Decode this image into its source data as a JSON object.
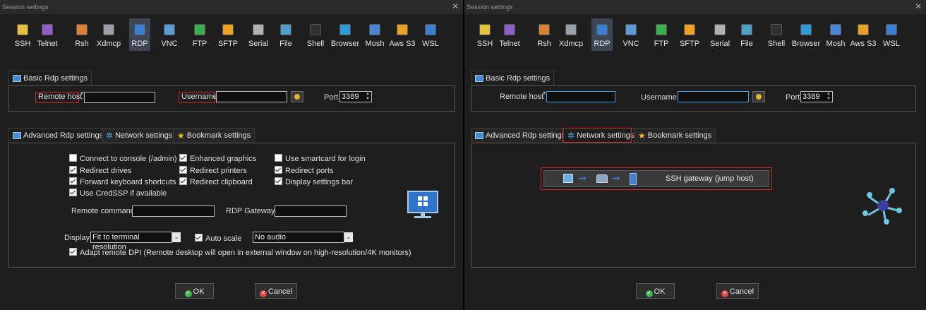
{
  "left": {
    "title": "Session settings",
    "toolbar": [
      {
        "label": "SSH",
        "icon": "ssh-icon",
        "color": "#e3c13b"
      },
      {
        "label": "Telnet",
        "icon": "telnet-icon",
        "color": "#8d5fc7"
      },
      {
        "label": "Rsh",
        "icon": "rsh-icon",
        "color": "#d88233"
      },
      {
        "label": "Xdmcp",
        "icon": "xdmcp-icon",
        "color": "#9aa0a8"
      },
      {
        "label": "RDP",
        "icon": "rdp-icon",
        "color": "#3a7fd0"
      },
      {
        "label": "VNC",
        "icon": "vnc-icon",
        "color": "#5b9bd8"
      },
      {
        "label": "FTP",
        "icon": "ftp-icon",
        "color": "#3fae4c"
      },
      {
        "label": "SFTP",
        "icon": "sftp-icon",
        "color": "#f0a020"
      },
      {
        "label": "Serial",
        "icon": "serial-icon",
        "color": "#b0b0b0"
      },
      {
        "label": "File",
        "icon": "file-icon",
        "color": "#4fa0c8"
      },
      {
        "label": "Shell",
        "icon": "shell-icon",
        "color": "#2f2f2f"
      },
      {
        "label": "Browser",
        "icon": "browser-icon",
        "color": "#2e9bd6"
      },
      {
        "label": "Mosh",
        "icon": "mosh-icon",
        "color": "#4a86d8"
      },
      {
        "label": "Aws S3",
        "icon": "aws-s3-icon",
        "color": "#e8a027"
      },
      {
        "label": "WSL",
        "icon": "wsl-icon",
        "color": "#3a7fd0"
      }
    ],
    "basic_tab": "Basic Rdp settings",
    "remote_host_label": "Remote host",
    "required_mark": "*",
    "remote_host_value": "",
    "username_label": "Username",
    "username_value": "",
    "port_label": "Port",
    "port_value": "3389",
    "tabs": [
      "Advanced Rdp settings",
      "Network settings",
      "Bookmark settings"
    ],
    "checkboxes": [
      {
        "label": "Connect to console (/admin)",
        "checked": false
      },
      {
        "label": "Enhanced graphics",
        "checked": true
      },
      {
        "label": "Use smartcard for login",
        "checked": false
      },
      {
        "label": "Redirect drives",
        "checked": true
      },
      {
        "label": "Redirect printers",
        "checked": true
      },
      {
        "label": "Redirect ports",
        "checked": true
      },
      {
        "label": "Forward keyboard shortcuts",
        "checked": true
      },
      {
        "label": "Redirect clipboard",
        "checked": true
      },
      {
        "label": "Display settings bar",
        "checked": true
      },
      {
        "label": "Use CredSSP if available",
        "checked": true
      }
    ],
    "remote_command_label": "Remote command",
    "rdp_gateway_label": "RDP Gateway",
    "display_label": "Display",
    "display_value": "Fit to terminal resolution",
    "auto_scale_label": "Auto scale",
    "auto_scale_checked": true,
    "audio_value": "No audio",
    "adapt_dpi_label": "Adapt remote DPI (Remote desktop will open in external window on high-resolution/4K monitors)",
    "adapt_dpi_checked": true,
    "ok_label": "OK",
    "cancel_label": "Cancel"
  },
  "right": {
    "title": "Session settings",
    "basic_tab": "Basic Rdp settings",
    "remote_host_label": "Remote host",
    "required_mark": "*",
    "username_label": "Username",
    "port_label": "Port",
    "port_value": "3389",
    "tabs": [
      "Advanced Rdp settings",
      "Network settings",
      "Bookmark settings"
    ],
    "ssh_gateway_label": "SSH gateway (jump host)",
    "ok_label": "OK",
    "cancel_label": "Cancel"
  },
  "colors": {
    "highlight": "#d0262c",
    "ok": "#3bb34a",
    "cancel": "#e04040",
    "selected_tool": "#3d4654"
  }
}
